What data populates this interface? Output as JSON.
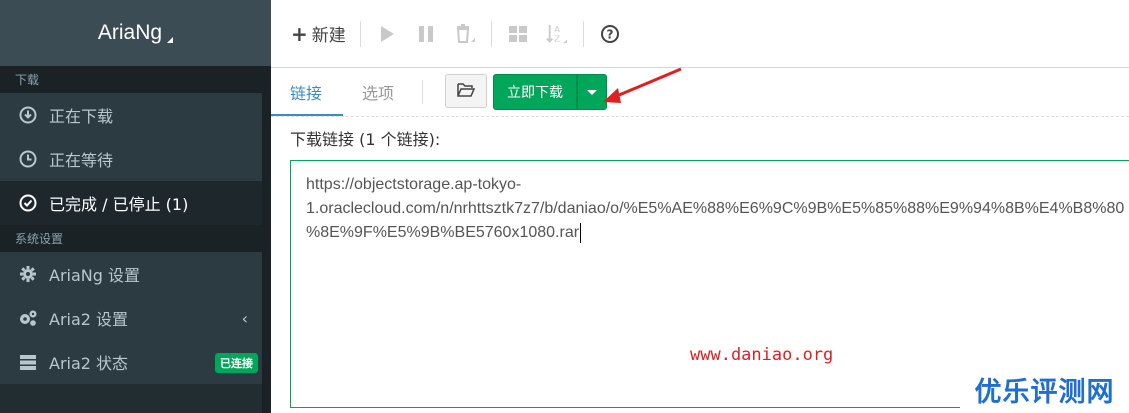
{
  "sidebar": {
    "brand": "AriaNg",
    "sections": [
      {
        "header": "下载"
      },
      {
        "header": "系统设置"
      }
    ],
    "items": [
      {
        "label": "正在下载",
        "icon": "download-circle-icon"
      },
      {
        "label": "正在等待",
        "icon": "clock-icon"
      },
      {
        "label": "已完成 / 已停止 (1)",
        "icon": "check-circle-icon"
      },
      {
        "label": "AriaNg 设置",
        "icon": "gear-icon"
      },
      {
        "label": "Aria2 设置",
        "icon": "gears-icon"
      },
      {
        "label": "Aria2 状态",
        "icon": "server-icon",
        "badge": "已连接"
      }
    ]
  },
  "toolbar": {
    "new_label": "新建",
    "icons": [
      "play-icon",
      "pause-icon",
      "trash-icon",
      "grid-icon",
      "sort-az-icon",
      "help-icon"
    ]
  },
  "tabs": [
    {
      "label": "链接",
      "active": true
    },
    {
      "label": "选项",
      "active": false
    }
  ],
  "actions": {
    "download_now": "立即下载"
  },
  "main": {
    "links_label": "下载链接 (1 个链接):",
    "textarea_lines": [
      "https://objectstorage.ap-tokyo-",
      "1.oraclecloud.com/n/nrhttsztk7z7/b/daniao/o/%E5%AE%88%E6%9C%9B%E5%85%88%E9%94%8B%E4%B8%80",
      "%8E%9F%E5%9B%BE5760x1080.rar"
    ]
  },
  "watermarks": {
    "site": "www.daniao.org",
    "brand": "优乐评测网"
  },
  "colors": {
    "accent_green": "#00a65a",
    "link_blue": "#3c8dbc",
    "sidebar_bg": "#222d32",
    "arrow_red": "#e02020"
  }
}
